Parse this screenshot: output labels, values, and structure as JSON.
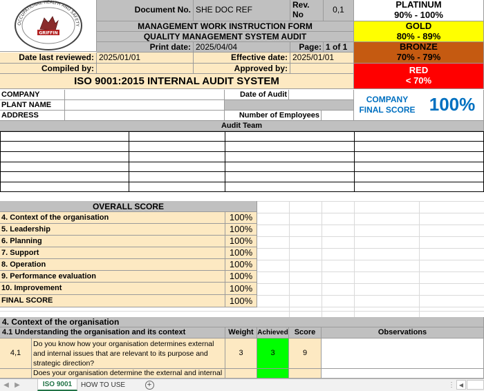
{
  "header": {
    "doc_no_label": "Document No.",
    "doc_no_value": "SHE DOC REF",
    "rev_label_1": "Rev.",
    "rev_label_2": "No",
    "rev_value": "0,1",
    "form_title": "MANAGEMENT WORK INSTRUCTION FORM",
    "form_subtitle": "QUALITY MANAGEMENT SYSTEM AUDIT",
    "print_date_label": "Print date:",
    "print_date_value": "2025/04/04",
    "page_label": "Page:",
    "page_value": "1 of 1",
    "date_reviewed_label": "Date last reviewed:",
    "date_reviewed_value": "2025/01/01",
    "effective_date_label": "Effective date:",
    "effective_date_value": "2025/01/01",
    "compiled_label": "Compiled by:",
    "approved_label": "Approved by:",
    "main_title": "ISO 9001:2015 INTERNAL AUDIT SYSTEM",
    "logo_text_top": "OCCUPATIONAL HEALTH AND SAFETY SOLUTIONS",
    "logo_name": "GRIFFIN"
  },
  "legend": [
    {
      "name": "PLATINUM",
      "range": "90% - 100%",
      "color": "#ffffff"
    },
    {
      "name": "GOLD",
      "range": "80% - 89%",
      "color": "#ffff00"
    },
    {
      "name": "BRONZE",
      "range": "70% - 79%",
      "color": "#c55a11"
    },
    {
      "name": "RED",
      "range": "< 70%",
      "color": "#ff0000"
    }
  ],
  "company": {
    "company_label": "COMPANY",
    "plant_label": "PLANT NAME",
    "address_label": "ADDRESS",
    "audit_date_label": "Date of Audit",
    "employees_label": "Number of Employees",
    "final_score_label_1": "COMPANY",
    "final_score_label_2": "FINAL SCORE",
    "final_score_value": "100%",
    "audit_team_label": "Audit Team"
  },
  "overall": {
    "title": "OVERALL SCORE",
    "rows": [
      {
        "label": "4. Context of the organisation",
        "value": "100%"
      },
      {
        "label": "5. Leadership",
        "value": "100%"
      },
      {
        "label": "6. Planning",
        "value": "100%"
      },
      {
        "label": "7. Support",
        "value": "100%"
      },
      {
        "label": "8. Operation",
        "value": "100%"
      },
      {
        "label": "9. Performance evaluation",
        "value": "100%"
      },
      {
        "label": "10. Improvement",
        "value": "100%"
      },
      {
        "label": "FINAL SCORE",
        "value": "100%"
      }
    ]
  },
  "section4": {
    "title": "4. Context of the organisation",
    "sub_title": "4.1 Understanding the organisation and its context",
    "col_weight": "Weight",
    "col_achieved": "Achieved",
    "col_score": "Score",
    "col_observations": "Observations",
    "q1_number": "4,1",
    "q1_text": "Do you know how your organisation determines external and internal issues that are relevant to its purpose and strategic direction?",
    "q1_weight": "3",
    "q1_achieved": "3",
    "q1_score": "9",
    "q2_text": "Does your organisation determine the external and internal"
  },
  "tabs": {
    "sheet1": "ISO 9001",
    "sheet2": "HOW TO USE",
    "add": "+"
  },
  "colors": {
    "header_gray": "#c0c0c0",
    "cream": "#fde9c2",
    "achieved_green": "#00ff00",
    "accent_blue": "#0070c0"
  }
}
